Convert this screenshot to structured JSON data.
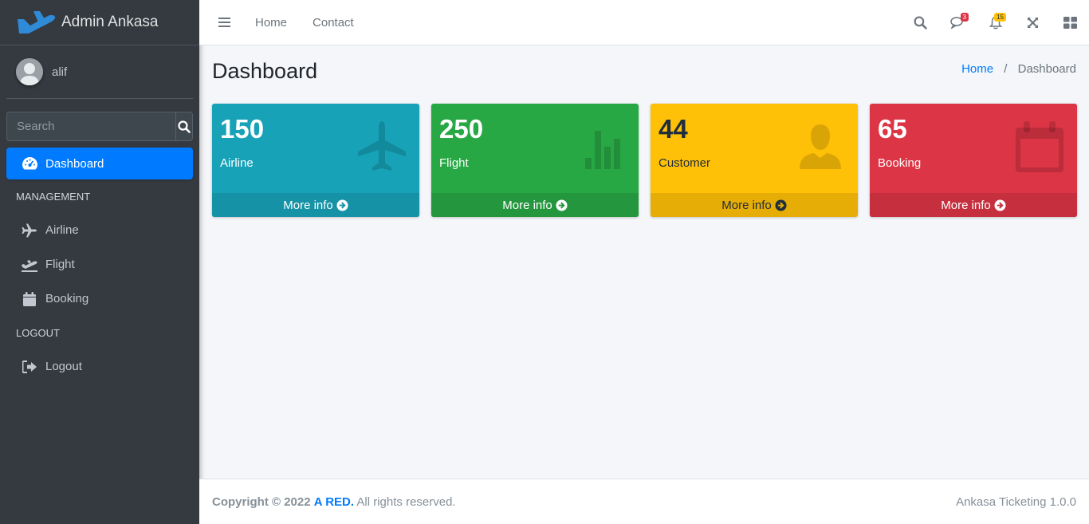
{
  "brand": {
    "name": "Admin Ankasa"
  },
  "user": {
    "name": "alif"
  },
  "search": {
    "placeholder": "Search"
  },
  "sidebar": {
    "active": {
      "label": "Dashboard",
      "icon": "tachometer-icon"
    },
    "sections": [
      {
        "header": "MANAGEMENT",
        "items": [
          {
            "label": "Airline",
            "icon": "plane-icon"
          },
          {
            "label": "Flight",
            "icon": "plane-departure-icon"
          },
          {
            "label": "Booking",
            "icon": "calendar-icon"
          }
        ]
      },
      {
        "header": "LOGOUT",
        "items": [
          {
            "label": "Logout",
            "icon": "sign-out-icon"
          }
        ]
      }
    ]
  },
  "topnav": {
    "links": [
      "Home",
      "Contact"
    ],
    "messages_badge": "3",
    "notifications_badge": "15"
  },
  "content": {
    "title": "Dashboard",
    "breadcrumb": [
      "Home",
      "Dashboard"
    ]
  },
  "boxes": [
    {
      "value": "150",
      "label": "Airline",
      "link": "More info",
      "icon": "plane-icon",
      "color": "#17a2b8"
    },
    {
      "value": "250",
      "label": "Flight",
      "link": "More info",
      "icon": "bar-chart-icon",
      "color": "#28a745"
    },
    {
      "value": "44",
      "label": "Customer",
      "link": "More info",
      "icon": "user-icon",
      "color": "#ffc107"
    },
    {
      "value": "65",
      "label": "Booking",
      "link": "More info",
      "icon": "calendar-icon",
      "color": "#dc3545"
    }
  ],
  "footer": {
    "copyright": "Copyright © 2022",
    "company": "A RED.",
    "rights": "All rights reserved.",
    "version": "Ankasa Ticketing 1.0.0"
  }
}
